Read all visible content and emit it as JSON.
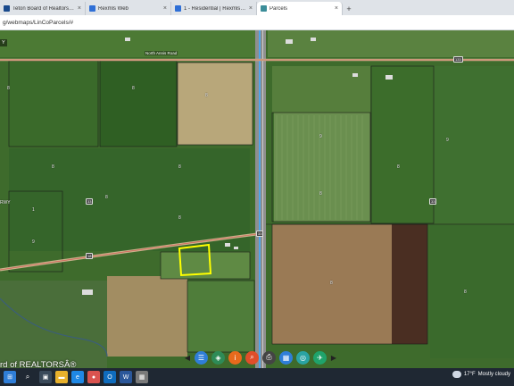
{
  "browser": {
    "tabs": [
      {
        "title": "Teton Board of Realtors Dashbo",
        "favicon_color": "#1a4a8c",
        "active": false
      },
      {
        "title": "Rexmls Web",
        "favicon_color": "#2f6fd6",
        "active": false
      },
      {
        "title": "1 - Residential | Rexmls Web",
        "favicon_color": "#2f6fd6",
        "active": false
      },
      {
        "title": "Parcels",
        "favicon_color": "#3b8d99",
        "active": true
      }
    ],
    "close_icon": "×",
    "new_tab_icon": "+",
    "url": "g/webmaps/LinCoParcels/#"
  },
  "map": {
    "road_label_north": "North Annis Road",
    "highway_shield_a": "133",
    "highway_shield_b": "33",
    "highway_shield_c": "33",
    "highway_shield_d": "33",
    "road_num_left": "18",
    "left_panel_stub": "Y",
    "left_label_partial": "RWY",
    "parcel_labels": [
      "8",
      "8",
      "8",
      "8",
      "9",
      "8",
      "8",
      "8",
      "8",
      "1",
      "9",
      "8",
      "9",
      "8",
      "8"
    ],
    "watermark": "rd of REALTORSÂ®",
    "selected_parcel_color": "#ffff00"
  },
  "map_tools": [
    {
      "name": "list-tool",
      "glyph": "☰",
      "color": "#2f7ed8"
    },
    {
      "name": "layers-tool",
      "glyph": "◈",
      "color": "#2e8b57"
    },
    {
      "name": "info-tool",
      "glyph": "i",
      "color": "#e86a1c"
    },
    {
      "name": "search-tool",
      "glyph": "⌕",
      "color": "#e04e2a"
    },
    {
      "name": "print-tool",
      "glyph": "⎙",
      "color": "#444444"
    },
    {
      "name": "basemap-tool",
      "glyph": "▦",
      "color": "#2f7ed8"
    },
    {
      "name": "measure-tool",
      "glyph": "◎",
      "color": "#2aa3a3"
    },
    {
      "name": "share-tool",
      "glyph": "✈",
      "color": "#1fa36b"
    }
  ],
  "map_tools_arrows": {
    "left": "◀",
    "right": "▶"
  },
  "taskbar": {
    "weather_temp": "17°F",
    "weather_text": "Mostly cloudy"
  }
}
